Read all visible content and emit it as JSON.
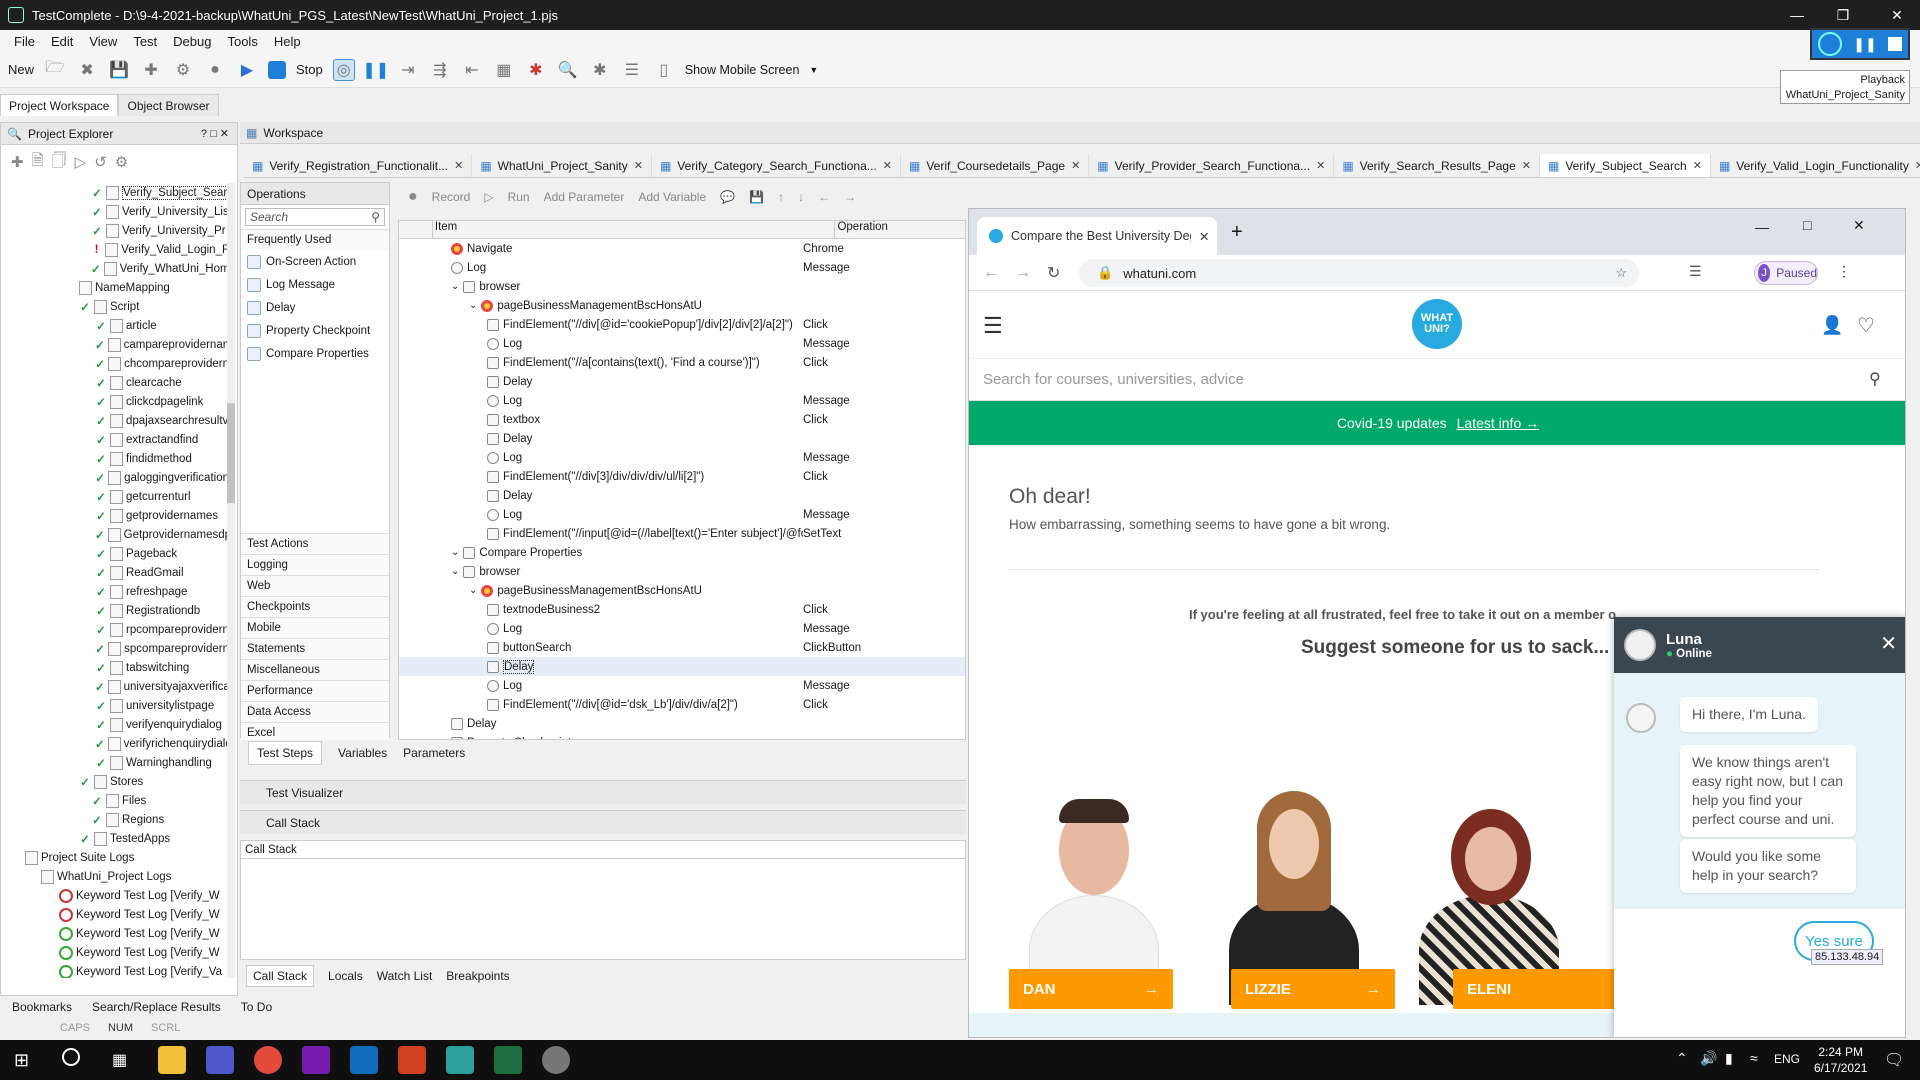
{
  "app": {
    "title": "TestComplete - D:\\9-4-2021-backup\\WhatUni_PGS_Latest\\NewTest\\WhatUni_Project_1.pjs"
  },
  "menu": [
    "File",
    "Edit",
    "View",
    "Test",
    "Debug",
    "Tools",
    "Help"
  ],
  "toolbar": {
    "new_label": "New",
    "stop_label": "Stop",
    "mobile_label": "Show Mobile Screen"
  },
  "playback": {
    "label": "Playback",
    "project": "WhatUni_Project_Sanity"
  },
  "panel_tabs": [
    "Project Workspace",
    "Object Browser"
  ],
  "explorer": {
    "title": "Project Explorer",
    "items": [
      {
        "label": "Verify_Subject_Sear",
        "state": "check"
      },
      {
        "label": "Verify_University_Lis",
        "state": "check"
      },
      {
        "label": "Verify_University_Pr",
        "state": "check"
      },
      {
        "label": "Verify_Valid_Login_F",
        "state": "error"
      },
      {
        "label": "Verify_WhatUni_Hom",
        "state": "check"
      },
      {
        "label": "NameMapping",
        "state": "none"
      },
      {
        "label": "Script",
        "state": "check"
      },
      {
        "label": "article",
        "state": "check"
      },
      {
        "label": "campareprovidernam",
        "state": "check"
      },
      {
        "label": "chcompareprovidern",
        "state": "check"
      },
      {
        "label": "clearcache",
        "state": "check"
      },
      {
        "label": "clickcdpagelink",
        "state": "check"
      },
      {
        "label": "dpajaxsearchresultv",
        "state": "check"
      },
      {
        "label": "extractandfind",
        "state": "check"
      },
      {
        "label": "findidmethod",
        "state": "check"
      },
      {
        "label": "galoggingverification",
        "state": "check"
      },
      {
        "label": "getcurrenturl",
        "state": "check"
      },
      {
        "label": "getprovidernames",
        "state": "check"
      },
      {
        "label": "Getprovidernamesdp",
        "state": "check"
      },
      {
        "label": "Pageback",
        "state": "check"
      },
      {
        "label": "ReadGmail",
        "state": "check"
      },
      {
        "label": "refreshpage",
        "state": "check"
      },
      {
        "label": "Registrationdb",
        "state": "check"
      },
      {
        "label": "rpcompareprovidern",
        "state": "check"
      },
      {
        "label": "spcompareprovidern",
        "state": "check"
      },
      {
        "label": "tabswitching",
        "state": "check"
      },
      {
        "label": "universityajaxverifica",
        "state": "check"
      },
      {
        "label": "universitylistpage",
        "state": "check"
      },
      {
        "label": "verifyenquirydialog",
        "state": "check"
      },
      {
        "label": "verifyrichenquirydialo",
        "state": "check"
      },
      {
        "label": "Warninghandling",
        "state": "check"
      },
      {
        "label": "Stores",
        "state": "check"
      },
      {
        "label": "Files",
        "state": "check"
      },
      {
        "label": "Regions",
        "state": "check"
      },
      {
        "label": "TestedApps",
        "state": "check"
      },
      {
        "label": "Project Suite Logs",
        "state": "none"
      },
      {
        "label": "WhatUni_Project Logs",
        "state": "none"
      },
      {
        "label": "Keyword Test Log [Verify_W",
        "state": "log-red"
      },
      {
        "label": "Keyword Test Log [Verify_W",
        "state": "log-red"
      },
      {
        "label": "Keyword Test Log [Verify_W",
        "state": "log-green"
      },
      {
        "label": "Keyword Test Log [Verify_W",
        "state": "log-green"
      },
      {
        "label": "Keyword Test Log [Verify_Va",
        "state": "log-green"
      }
    ]
  },
  "workspace": {
    "title": "Workspace",
    "tabs": [
      "Verify_Registration_Functionalit...",
      "WhatUni_Project_Sanity",
      "Verify_Category_Search_Functiona...",
      "Verif_Coursedetails_Page",
      "Verify_Provider_Search_Functiona...",
      "Verify_Search_Results_Page",
      "Verify_Subject_Search",
      "Verify_Valid_Login_Functionality"
    ]
  },
  "operations": {
    "title": "Operations",
    "search_placeholder": "Search",
    "frequent_title": "Frequently Used",
    "items": [
      "On-Screen Action",
      "Log Message",
      "Delay",
      "Property Checkpoint",
      "Compare Properties"
    ],
    "categories": [
      "Test Actions",
      "Logging",
      "Web",
      "Checkpoints",
      "Mobile",
      "Statements",
      "Miscellaneous",
      "Performance",
      "Data Access",
      "Excel"
    ]
  },
  "kwtoolbar": {
    "record": "Record",
    "run": "Run",
    "add_param": "Add Parameter",
    "add_var": "Add Variable"
  },
  "grid": {
    "col_item": "Item",
    "col_operation": "Operation",
    "rows": [
      {
        "i": 1,
        "type": "chrome",
        "item": "Navigate",
        "op": "Chrome"
      },
      {
        "i": 1,
        "type": "log",
        "item": "Log",
        "op": "Message"
      },
      {
        "i": 1,
        "type": "group",
        "item": "browser",
        "op": ""
      },
      {
        "i": 2,
        "type": "chrome",
        "item": "pageBusinessManagementBscHonsAtU",
        "op": ""
      },
      {
        "i": 3,
        "type": "click",
        "item": "FindElement(\"//div[@id='cookiePopup']/div[2]/div[2]/a[2]\")",
        "op": "Click"
      },
      {
        "i": 3,
        "type": "log",
        "item": "Log",
        "op": "Message"
      },
      {
        "i": 3,
        "type": "click",
        "item": "FindElement(\"//a[contains(text(), 'Find a course')]\")",
        "op": "Click"
      },
      {
        "i": 3,
        "type": "click",
        "item": "Delay",
        "op": ""
      },
      {
        "i": 3,
        "type": "log",
        "item": "Log",
        "op": "Message"
      },
      {
        "i": 3,
        "type": "click",
        "item": "textbox",
        "op": "Click"
      },
      {
        "i": 3,
        "type": "click",
        "item": "Delay",
        "op": ""
      },
      {
        "i": 3,
        "type": "log",
        "item": "Log",
        "op": "Message"
      },
      {
        "i": 3,
        "type": "click",
        "item": "FindElement(\"//div[3]/div/div/div/ul/li[2]\")",
        "op": "Click"
      },
      {
        "i": 3,
        "type": "click",
        "item": "Delay",
        "op": ""
      },
      {
        "i": 3,
        "type": "log",
        "item": "Log",
        "op": "Message"
      },
      {
        "i": 3,
        "type": "click",
        "item": "FindElement(\"//input[@id=(//label[text()='Enter subject']/@for)]\")",
        "op": "SetText"
      },
      {
        "i": 1,
        "type": "group",
        "item": "Compare Properties",
        "op": ""
      },
      {
        "i": 1,
        "type": "group",
        "item": "browser",
        "op": ""
      },
      {
        "i": 2,
        "type": "chrome",
        "item": "pageBusinessManagementBscHonsAtU",
        "op": ""
      },
      {
        "i": 3,
        "type": "click",
        "item": "textnodeBusiness2",
        "op": "Click"
      },
      {
        "i": 3,
        "type": "log",
        "item": "Log",
        "op": "Message"
      },
      {
        "i": 3,
        "type": "click",
        "item": "buttonSearch",
        "op": "ClickButton"
      },
      {
        "i": 3,
        "type": "click",
        "item": "Delay",
        "op": "",
        "sel": true
      },
      {
        "i": 3,
        "type": "log",
        "item": "Log",
        "op": "Message"
      },
      {
        "i": 3,
        "type": "click",
        "item": "FindElement(\"//div[@id='dsk_Lb']/div/div/a[2]\")",
        "op": "Click"
      },
      {
        "i": 1,
        "type": "click",
        "item": "Delay",
        "op": ""
      },
      {
        "i": 1,
        "type": "click",
        "item": "Property Checkpoint",
        "op": ""
      }
    ]
  },
  "steptabs": [
    "Test Steps",
    "Variables",
    "Parameters"
  ],
  "test_visualizer": "Test Visualizer",
  "call_stack_title": "Call Stack",
  "call_stack_header": "Call Stack",
  "bottom_tabs": [
    "Call Stack",
    "Locals",
    "Watch List",
    "Breakpoints"
  ],
  "low_tabs": [
    "Bookmarks",
    "Search/Replace Results",
    "To Do"
  ],
  "status": [
    "CAPS",
    "NUM",
    "SCRL"
  ],
  "browser": {
    "tab_title": "Compare the Best University Deg",
    "url": "whatuni.com",
    "profile": "Paused",
    "search_placeholder": "Search for courses, universities, advice",
    "logo": "WHAT UNI?",
    "covid_text": "Covid-19 updates",
    "covid_link": "Latest info →",
    "oh_dear": "Oh dear!",
    "embarrassed": "How embarrassing, something seems to have gone a bit wrong.",
    "frustrated": "If you're feeling at all frustrated, feel free to take it out on a member o",
    "suggest": "Suggest someone for us to sack...",
    "people": [
      "DAN",
      "LIZZIE",
      "ELENI"
    ],
    "arrow": "→"
  },
  "chat": {
    "name": "Luna",
    "status": "Online",
    "msg1": "Hi there, I'm Luna.",
    "msg2": "We know things aren't easy right now, but I can help you find your perfect course and uni.",
    "msg3": "Would you like some help in your search?",
    "reply": "Yes sure",
    "ip": "85.133.48.94"
  },
  "taskbar": {
    "time": "2:24 PM",
    "date": "6/17/2021",
    "lang": "ENG"
  },
  "colors": {
    "accent": "#00a86b",
    "orange": "#ff9900",
    "whatuni_blue": "#28aae1",
    "chat_head": "#3a4650"
  }
}
